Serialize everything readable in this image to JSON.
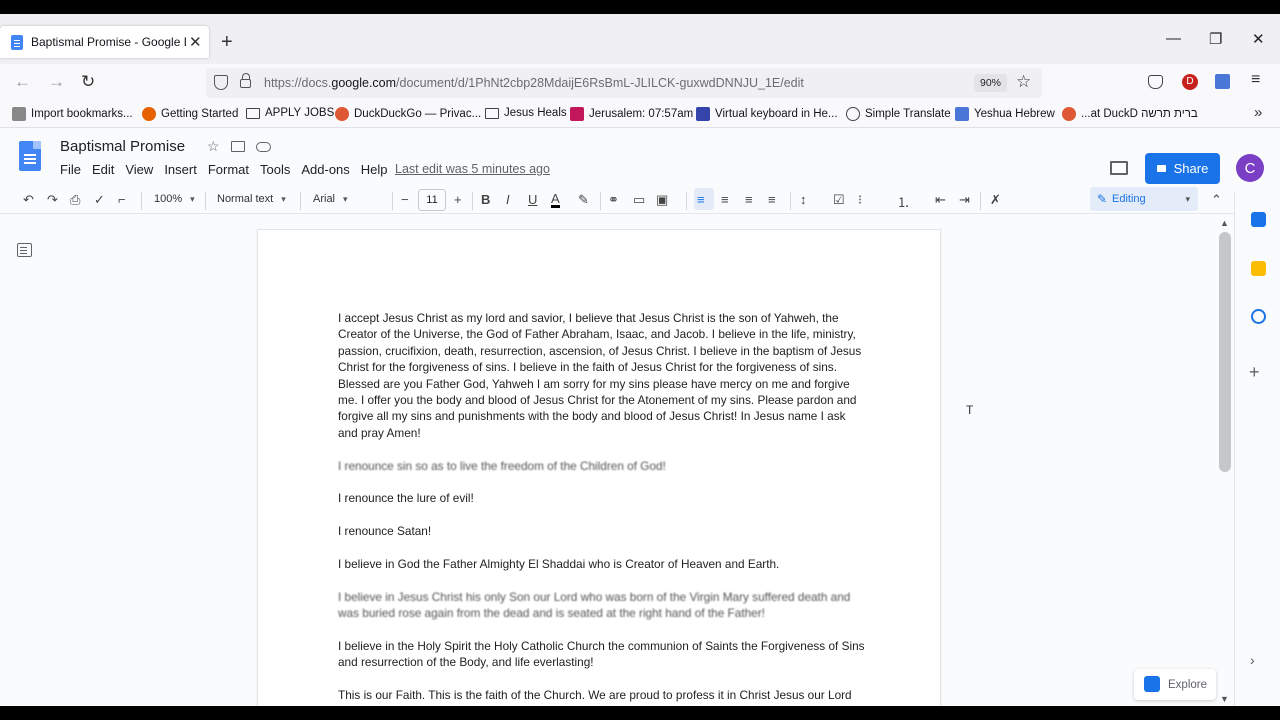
{
  "browser": {
    "tab_title": "Baptismal Promise - Google Docs",
    "new_tab": "+",
    "url_host_prefix": "https://docs.",
    "url_host": "google.com",
    "url_path": "/document/d/1PhNt2cbp28MdaijE6RsBmL-JLILCK-guxwdDNNJU_1E/edit",
    "zoom": "90%",
    "window_controls": [
      "—",
      "❐",
      "✕"
    ]
  },
  "bookmarks": [
    {
      "label": "Import bookmarks...",
      "icon": "import-icon"
    },
    {
      "label": "Getting Started",
      "icon": "firefox-icon"
    },
    {
      "label": "APPLY JOBS",
      "icon": "folder-icon"
    },
    {
      "label": "DuckDuckGo — Privac...",
      "icon": "duckduckgo-icon"
    },
    {
      "label": "Jesus Heals",
      "icon": "folder-icon"
    },
    {
      "label": "Jerusalem: 07:57am",
      "icon": "clock-icon"
    },
    {
      "label": "Virtual keyboard in He...",
      "icon": "keyboard-icon"
    },
    {
      "label": "Simple Translate",
      "icon": "globe-icon"
    },
    {
      "label": "Yeshua Hebrew",
      "icon": "translate-icon"
    },
    {
      "label": "...at DuckD ברית תרשה",
      "icon": "duckduckgo-icon"
    }
  ],
  "docs": {
    "title": "Baptismal Promise",
    "menu": [
      "File",
      "Edit",
      "View",
      "Insert",
      "Format",
      "Tools",
      "Add-ons",
      "Help"
    ],
    "last_edit": "Last edit was 5 minutes ago",
    "share_label": "Share",
    "avatar_letter": "C"
  },
  "toolbar": {
    "zoom": "100%",
    "style": "Normal text",
    "font": "Arial",
    "font_size": "11",
    "mode": "Editing"
  },
  "document": {
    "paragraphs": [
      {
        "text": "I accept Jesus Christ as my lord and savior, I believe that Jesus Christ is the son of Yahweh, the Creator of the Universe, the God of Father Abraham, Isaac, and Jacob.  I believe in the life, ministry, passion, crucifixion, death, resurrection, ascension, of Jesus Christ.  I believe in the baptism of Jesus Christ for the forgiveness of sins.  I believe in the faith of Jesus Christ for the forgiveness of sins.  Blessed are you Father God, Yahweh I am sorry for my sins please have mercy on me and forgive me.  I offer you the body and blood of Jesus Christ for the Atonement of my sins.  Please pardon and forgive all my sins and punishments with the body and blood of Jesus Christ!  In Jesus name I ask and pray Amen!",
        "blurred": false
      },
      {
        "text": "I renounce sin so as to live the freedom of the Children of God!",
        "blurred": true
      },
      {
        "text": "I renounce the lure of evil!",
        "blurred": false
      },
      {
        "text": "I renounce Satan!",
        "blurred": false
      },
      {
        "text": "I believe in God the Father Almighty El Shaddai who is Creator of Heaven and Earth.",
        "blurred": false
      },
      {
        "text": "I believe in Jesus Christ his only Son our Lord who was born of the Virgin Mary suffered death and was buried rose again from the dead and is seated at the right hand of the Father!",
        "blurred": true
      },
      {
        "text": "I believe in the Holy Spirit the Holy Catholic Church the communion of Saints the Forgiveness of Sins and resurrection of the Body, and life everlasting!",
        "blurred": false
      },
      {
        "text": "This is our Faith.  This is the faith of the Church.  We are proud to profess it in Christ Jesus our Lord Amen",
        "blurred": false
      }
    ]
  },
  "side": {
    "explore_label": "Explore"
  },
  "colors": {
    "accent": "#1a73e8",
    "docs_blue": "#4285f4",
    "avatar": "#7b3fc6"
  }
}
